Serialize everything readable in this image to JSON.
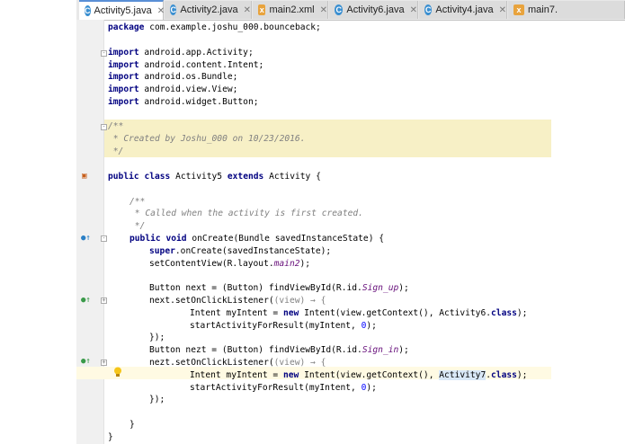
{
  "tabs": [
    {
      "label": "Activity5.java",
      "type": "java",
      "active": true
    },
    {
      "label": "Activity2.java",
      "type": "java",
      "active": false
    },
    {
      "label": "main2.xml",
      "type": "xml",
      "active": false
    },
    {
      "label": "Activity6.java",
      "type": "java",
      "active": false
    },
    {
      "label": "Activity4.java",
      "type": "java",
      "active": false
    },
    {
      "label": "main7.",
      "type": "xml",
      "active": false
    }
  ],
  "code": {
    "package_kw": "package",
    "package_name": " com.example.joshu_000.bounceback;",
    "import_kw": "import",
    "imports": [
      " android.app.Activity;",
      " android.content.Intent;",
      " android.os.Bundle;",
      " android.view.View;",
      " android.widget.Button;"
    ],
    "comment_open": "/**",
    "comment_created": " * Created by Joshu_000 on 10/23/2016.",
    "comment_close": " */",
    "class_public": "public",
    "class_kw": "class",
    "class_name": " Activity5 ",
    "extends_kw": "extends",
    "class_parent": " Activity {",
    "doc_open": "/**",
    "doc_called": " * Called when the activity is first created.",
    "doc_close": " */",
    "oncreate_void": "void",
    "oncreate_sig": " onCreate(Bundle savedInstanceState) {",
    "super_kw": "super",
    "super_call": ".onCreate(savedInstanceState);",
    "setcontent_a": "setContentView(R.layout.",
    "setcontent_field": "main2",
    "setcontent_b": ");",
    "next_decl_a": "Button next = (Button) findViewById(R.id.",
    "next_decl_field": "Sign_up",
    "next_decl_b": ");",
    "listener_a_pre": "next.setOnClickListener(",
    "listener_lambda": "(view) → {",
    "intent_a_pre": "Intent myIntent = ",
    "new_kw": "new",
    "intent_a_mid": " Intent(view.getContext(), Activity6.",
    "class_kw2": "class",
    "intent_end": ");",
    "start_a_pre": "startActivityForResult(myIntent, ",
    "start_num": "0",
    "close_lambda": "});",
    "nezt_decl_a": "Button nezt = (Button) findViewById(R.id.",
    "nezt_decl_field": "Sign_in",
    "listener_b_pre": "nezt.setOnClickListener(",
    "intent_b_mid": " Intent(view.getContext(), ",
    "intent_b_sel": "Activity7",
    "intent_b_dot": ".",
    "close_brace": "}"
  },
  "colors": {
    "keyword": "#000080",
    "comment": "#808080",
    "field": "#660e7a",
    "number": "#0000ff",
    "comment_band": "#f7f0c6"
  },
  "icons": [
    "java-class-icon",
    "xml-file-icon",
    "override-marker-icon",
    "lightbulb-icon",
    "fold-icon"
  ]
}
